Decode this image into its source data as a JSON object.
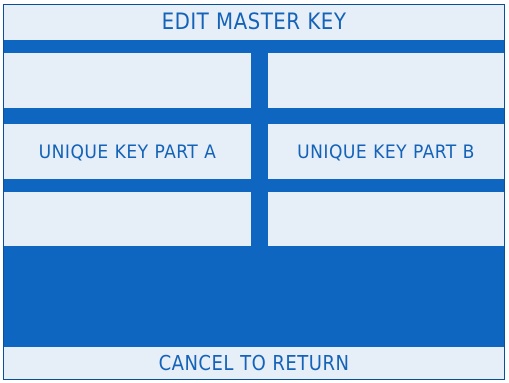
{
  "screen": {
    "title": "EDIT MASTER KEY",
    "footer": "CANCEL TO RETURN"
  },
  "options": {
    "left_top": "",
    "right_top": "",
    "key_part_a": "UNIQUE KEY PART A",
    "key_part_b": "UNIQUE KEY PART B",
    "left_bottom": "",
    "right_bottom": ""
  },
  "colors": {
    "background_blue": "#0e66c0",
    "panel": "#e6eef8",
    "text": "#1463b8"
  }
}
